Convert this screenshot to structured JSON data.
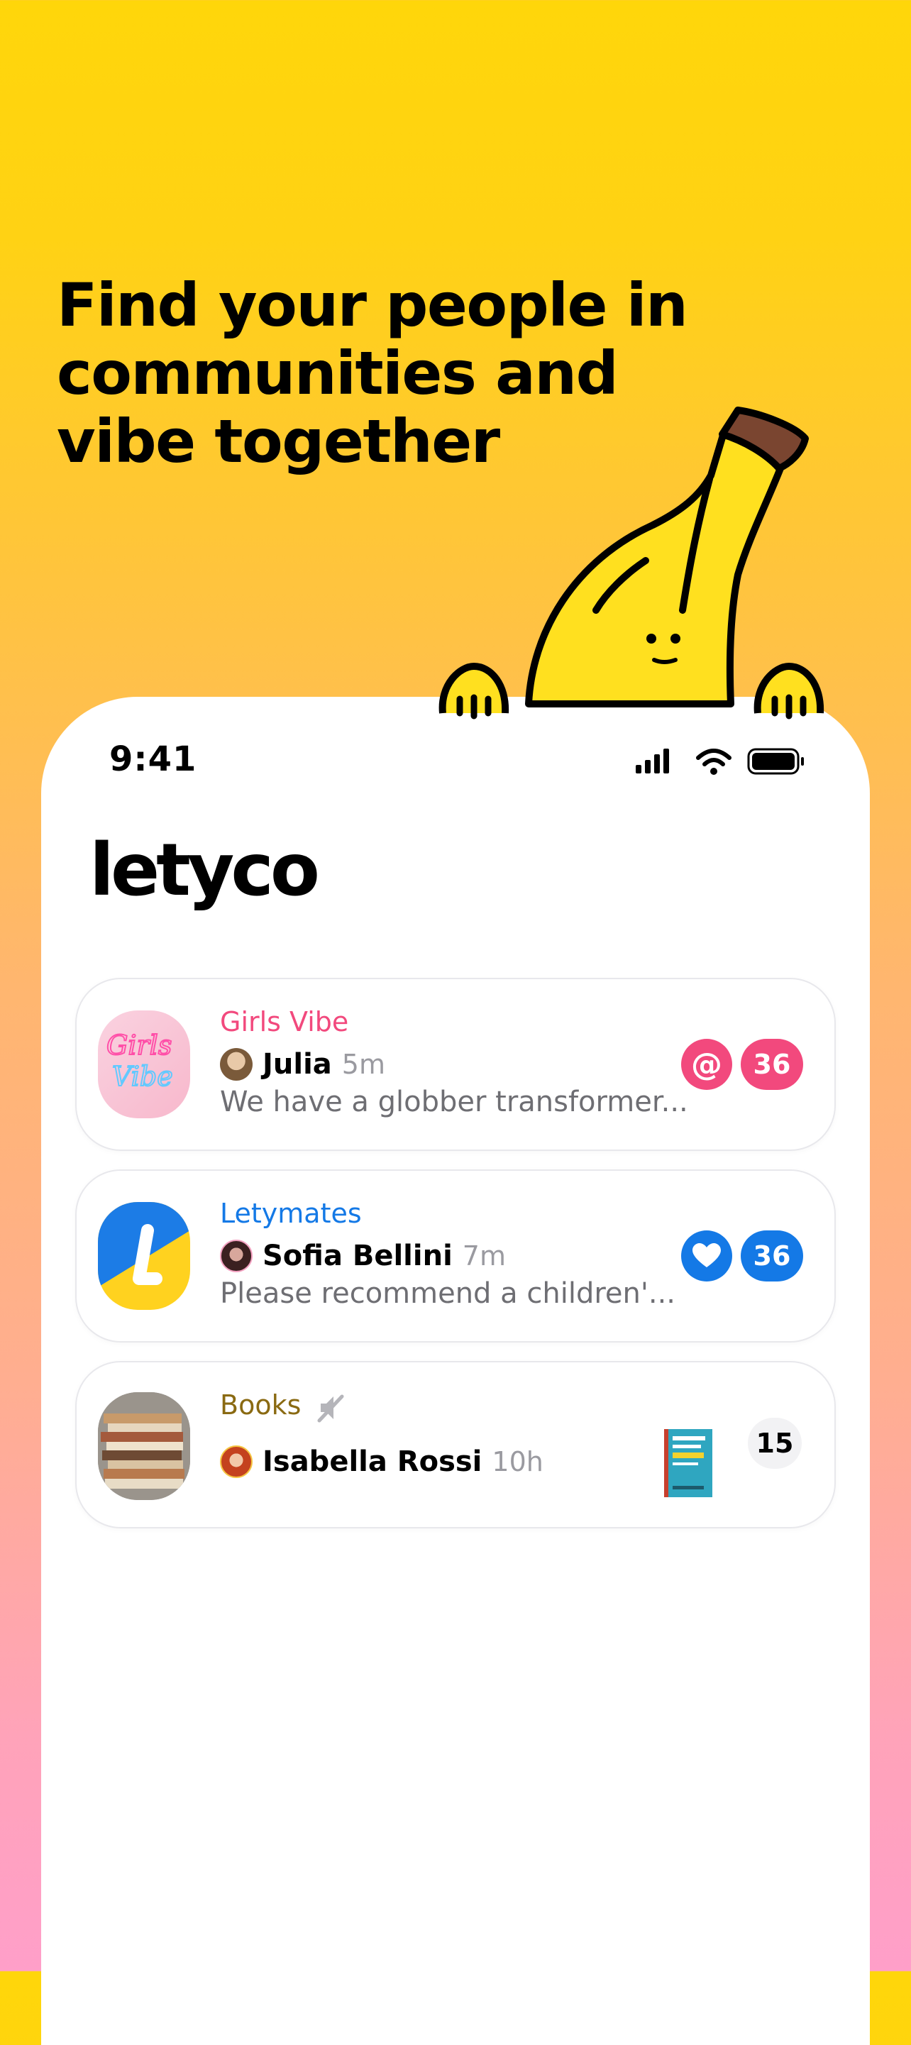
{
  "promo": {
    "headline": [
      "Find your people in",
      "communities and",
      "vibe together"
    ]
  },
  "status_bar": {
    "time": "9:41"
  },
  "app": {
    "logo": "letyco",
    "logo_mark": "™"
  },
  "chats": [
    {
      "community": "Girls Vibe",
      "community_color": "#F2497D",
      "thumb_text": [
        "Girls",
        "Vibe"
      ],
      "author": "Julia",
      "time": "5m",
      "preview": "We have a globber transformer...",
      "indicator": "mention-icon",
      "indicator_glyph": "@",
      "unread": "36",
      "badge_color": "#F2497D"
    },
    {
      "community": "Letymates",
      "community_color": "#1479E6",
      "author": "Sofia Bellini",
      "time": "7m",
      "preview": "Please recommend a children'...",
      "indicator": "heart-icon",
      "unread": "36",
      "badge_color": "#1479E6"
    },
    {
      "community": "Books",
      "community_color": "#8A6A12",
      "muted": true,
      "author": "Isabella Rossi",
      "time": "10h",
      "attachment": "book-cover-image",
      "unread": "15",
      "badge_color": "#F2F2F4"
    }
  ]
}
